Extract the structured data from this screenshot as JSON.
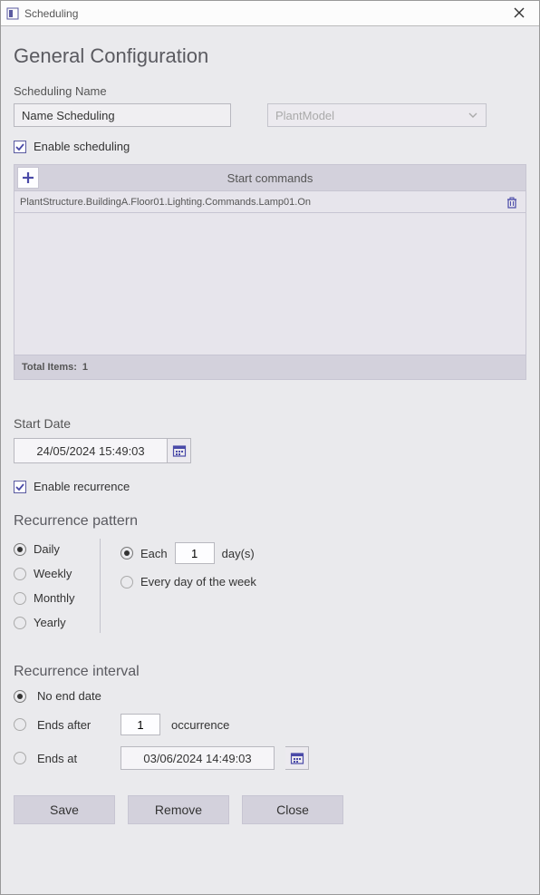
{
  "window": {
    "title": "Scheduling"
  },
  "page": {
    "heading": "General Configuration",
    "nameLabel": "Scheduling Name",
    "nameValue": "Name Scheduling",
    "modelPlaceholder": "PlantModel",
    "enableSchedulingLabel": "Enable scheduling",
    "enableSchedulingChecked": true
  },
  "commands": {
    "headerLabel": "Start commands",
    "items": [
      {
        "text": "PlantStructure.BuildingA.Floor01.Lighting.Commands.Lamp01.On"
      }
    ],
    "totalLabel": "Total Items:",
    "totalCount": "1"
  },
  "startDate": {
    "label": "Start Date",
    "value": "24/05/2024 15:49:03"
  },
  "recurrence": {
    "enableLabel": "Enable recurrence",
    "enableChecked": true,
    "patternHeading": "Recurrence pattern",
    "options": {
      "daily": "Daily",
      "weekly": "Weekly",
      "monthly": "Monthly",
      "yearly": "Yearly"
    },
    "selected": "daily",
    "eachLabel": "Each",
    "eachValue": "1",
    "eachUnit": "day(s)",
    "everyDayLabel": "Every day of the week"
  },
  "interval": {
    "heading": "Recurrence interval",
    "noEndLabel": "No end date",
    "endsAfterLabel": "Ends after",
    "endsAfterValue": "1",
    "occurrenceLabel": "occurrence",
    "endsAtLabel": "Ends at",
    "endsAtValue": "03/06/2024 14:49:03",
    "selected": "noEnd"
  },
  "buttons": {
    "save": "Save",
    "remove": "Remove",
    "close": "Close"
  }
}
